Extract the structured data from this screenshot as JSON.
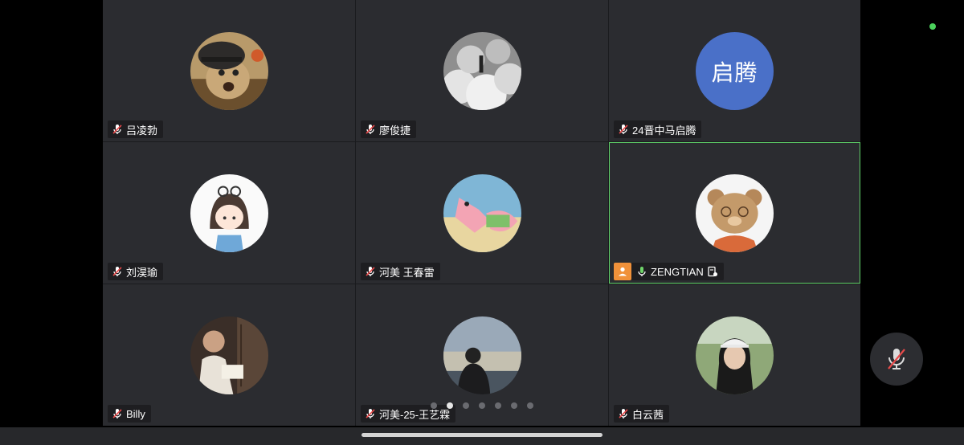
{
  "participants": [
    {
      "name": "吕凌勃",
      "avatar": "cat-helmet-photo"
    },
    {
      "name": "廖俊捷",
      "avatar": "clouds-photo"
    },
    {
      "name": "24晋中马启腾",
      "avatar_text": "启腾",
      "avatar_color": "#4a70c8"
    },
    {
      "name": "刘淏瑜",
      "avatar": "cartoon-girl-drawing"
    },
    {
      "name": "河美 王春雷",
      "avatar": "patrick-star-photo"
    },
    {
      "name": "ZENGTIAN",
      "avatar": "bear-drawing",
      "host": true,
      "speaking": true
    },
    {
      "name": "Billy",
      "avatar": "reading-person-photo"
    },
    {
      "name": "河美-25-王艺霖",
      "avatar": "person-sunset-photo"
    },
    {
      "name": "白云茜",
      "avatar": "woman-cap-photo"
    }
  ],
  "pagination": {
    "total": 7,
    "current": 2
  },
  "colors": {
    "active_border": "#5fd068",
    "host_badge": "#f0913a",
    "status": "#4bd25c"
  }
}
